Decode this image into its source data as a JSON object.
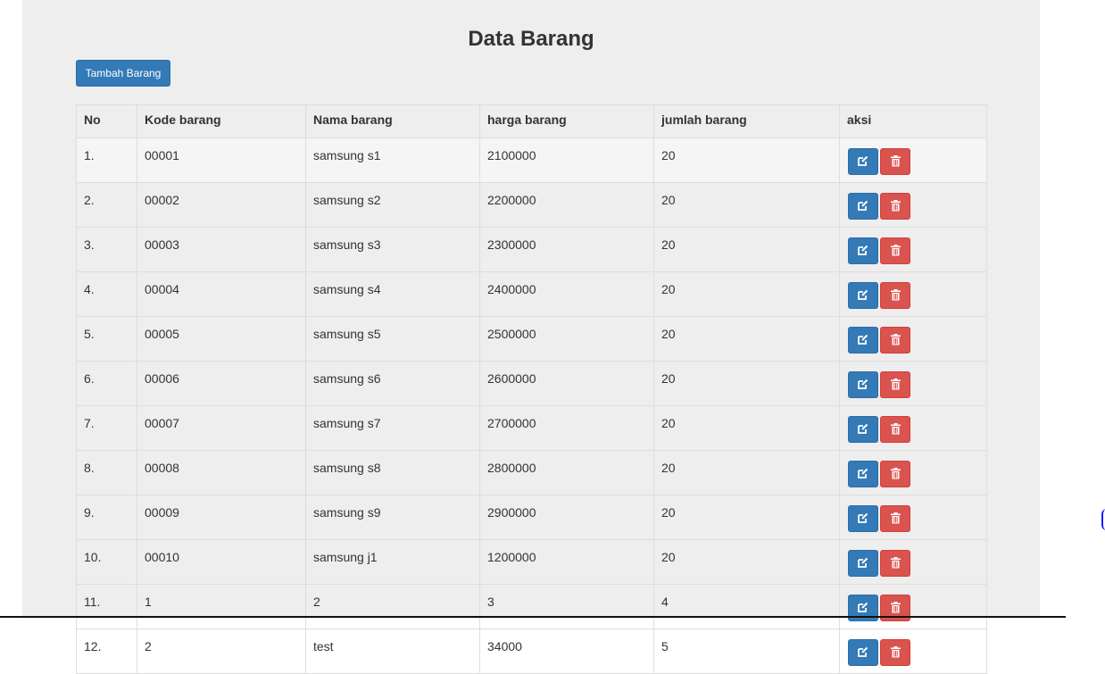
{
  "page": {
    "title": "Data Barang",
    "add_button_label": "Tambah Barang"
  },
  "table": {
    "headers": {
      "no": "No",
      "kode": "Kode barang",
      "nama": "Nama barang",
      "harga": "harga barang",
      "jumlah": "jumlah barang",
      "aksi": "aksi"
    },
    "rows": [
      {
        "no": "1.",
        "kode": "00001",
        "nama": "samsung s1",
        "harga": "2100000",
        "jumlah": "20"
      },
      {
        "no": "2.",
        "kode": "00002",
        "nama": "samsung s2",
        "harga": "2200000",
        "jumlah": "20"
      },
      {
        "no": "3.",
        "kode": "00003",
        "nama": "samsung s3",
        "harga": "2300000",
        "jumlah": "20"
      },
      {
        "no": "4.",
        "kode": "00004",
        "nama": "samsung s4",
        "harga": "2400000",
        "jumlah": "20"
      },
      {
        "no": "5.",
        "kode": "00005",
        "nama": "samsung s5",
        "harga": "2500000",
        "jumlah": "20"
      },
      {
        "no": "6.",
        "kode": "00006",
        "nama": "samsung s6",
        "harga": "2600000",
        "jumlah": "20"
      },
      {
        "no": "7.",
        "kode": "00007",
        "nama": "samsung s7",
        "harga": "2700000",
        "jumlah": "20"
      },
      {
        "no": "8.",
        "kode": "00008",
        "nama": "samsung s8",
        "harga": "2800000",
        "jumlah": "20"
      },
      {
        "no": "9.",
        "kode": "00009",
        "nama": "samsung s9",
        "harga": "2900000",
        "jumlah": "20"
      },
      {
        "no": "10.",
        "kode": "00010",
        "nama": "samsung j1",
        "harga": "1200000",
        "jumlah": "20"
      },
      {
        "no": "11.",
        "kode": "1",
        "nama": "2",
        "harga": "3",
        "jumlah": "4"
      },
      {
        "no": "12.",
        "kode": "2",
        "nama": "test",
        "harga": "34000",
        "jumlah": "5"
      }
    ],
    "row_actions": [
      {
        "name": "edit-button",
        "icon": "edit-icon",
        "color": "#337ab7"
      },
      {
        "name": "delete-button",
        "icon": "trash-icon",
        "color": "#d9534f"
      }
    ]
  },
  "colors": {
    "primary": "#337ab7",
    "danger": "#d9534f",
    "panel_bg": "#eeeeee"
  }
}
